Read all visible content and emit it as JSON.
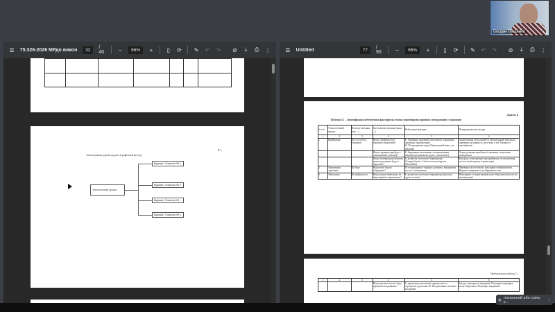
{
  "camera": {
    "participant_name": "Богдан Пащенко"
  },
  "left_viewer": {
    "title": "75.326-2026 МРдо викона...",
    "page_current": "32",
    "page_total": "/ 40",
    "zoom": "66%",
    "page2": {
      "section": "В.7.",
      "diagram_title": "Аналізування дерева відмов (графічний метод)",
      "root": "Технологічний процес",
      "branches": [
        "Відмова / Помилка НЗ 1",
        "Відмова / Помилка НЗ 2",
        "Відмова / Помилка НЗ ...",
        "Відмова / Помилка НЗ n"
      ]
    }
  },
  "right_viewer": {
    "title": "Untitled",
    "page_current": "77",
    "page_total": "/ 90",
    "zoom": "66%",
    "appendix": "Додаток Б",
    "table_title": "Таблиця 3.1 – Ідентифікація небезпечних факторів на етапах виробництва приміків спецурованих з'єднанням",
    "headers": [
      "№ п/п",
      "Технологічний процес",
      "Почасне питання (що ...)",
      "Заготовлене питання (якщо ...)",
      "Небезпечні фактори",
      "Попереджувальні заходи"
    ],
    "col_numbers": [
      "1",
      "2",
      "3",
      "4",
      "5",
      "6"
    ],
    "rows": [
      [
        "1",
        "Приймання",
        "Це стосується упаковки",
        "Якщо сировина буде заражена мікробами?",
        "Б: Уражання сировини патогенами. Зараження продукції мікрофлорою.\nФ: Пошкодження тари (Зберігальний вміст, не дійсний)",
        "Аналізування (візуальний та лабораторний контроль) сировини на наявність патогенів у тій. Наявність сертифікатів."
      ],
      [
        "",
        "",
        "",
        "Якщо сировина прибуде у пошкодженій упаковці?",
        "Б: Зараження патогенами та накопичення мікрофлори (кишкова група, сальмонела)",
        "Огляд упаковки прибувшої сировини, вилучення ушкодженої."
      ],
      [
        "",
        "",
        "",
        "Якщо температурні режими транспортування будуть порушені?",
        "Б: розвиток патогенної мікрофлори (Campylobacter, Listeria monocytogenes, Salmonella)",
        "Контроль температури при прийманні, встановлення систем моніторингу в транспорті."
      ],
      [
        "2",
        "Зважування сировини",
        "Це буде",
        "Якщо ваги будуть забруднені?",
        "Ф: потрапляння сторонніх домішок, випадкових часток з обладнання",
        "Перевірка чистоти ваги, регулярне очищення ваги. Журнал очищення та калібрування ваги."
      ],
      [
        "3",
        "Зберігання",
        "Це відбудеться",
        "Якщо умови зберігання не відповідають нормативам?",
        "Б: розвиток патогенної мікрофлори (розсіяні групи та інші)",
        "Моніторинг та корегування умов зберігання (вологість, температура)."
      ]
    ],
    "continuation": "Продовження таблиці 3.1",
    "cont_row": [
      "",
      "",
      "",
      "Якщо пролиті вологої буде заражена шкідниками?",
      "Б: зараження патогенами переносних та перехресне ураження.\nФ: Потрапляння частинок шкідників",
      "Заходи з контролю шкідників. Регулярна перевірка місць зберігання. Перевірка шкідників."
    ]
  },
  "notification": {
    "text": "локальний або спіль-к..."
  }
}
